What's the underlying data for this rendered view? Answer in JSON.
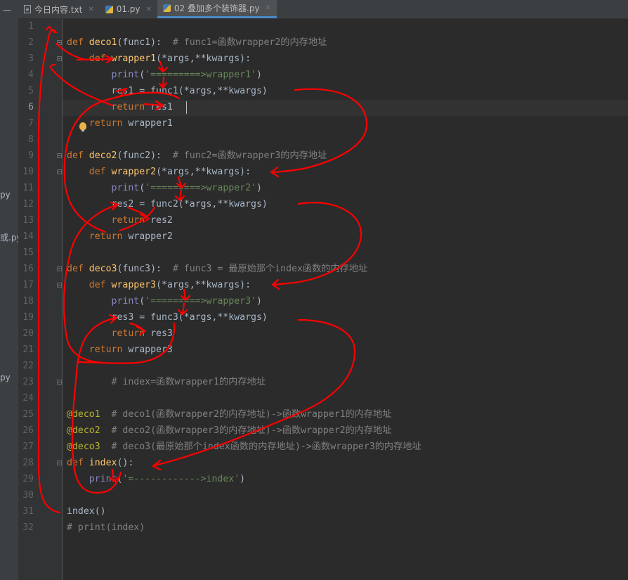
{
  "left_strip": {
    "fragments": [
      "py",
      "或.py",
      "py"
    ]
  },
  "tabs": [
    {
      "label": "今日内容.txt",
      "icon": "text-file-icon",
      "active": false
    },
    {
      "label": "01.py",
      "icon": "python-file-icon",
      "active": false
    },
    {
      "label": "02 叠加多个装饰器.py",
      "icon": "python-file-icon",
      "active": true
    }
  ],
  "editor": {
    "current_line": 6,
    "line_numbers": [
      "1",
      "2",
      "3",
      "4",
      "5",
      "6",
      "7",
      "8",
      "9",
      "10",
      "11",
      "12",
      "13",
      "14",
      "15",
      "16",
      "17",
      "18",
      "19",
      "20",
      "21",
      "22",
      "23",
      "24",
      "25",
      "26",
      "27",
      "28",
      "29",
      "30",
      "31",
      "32"
    ],
    "lines": [
      [],
      [
        [
          "kw",
          "def "
        ],
        [
          "fn",
          "deco1"
        ],
        [
          "p",
          "(func1):  "
        ],
        [
          "com",
          "# func1=函数wrapper2的内存地址"
        ]
      ],
      [
        [
          "p",
          "    "
        ],
        [
          "kw",
          "def "
        ],
        [
          "fn",
          "wrapper1"
        ],
        [
          "p",
          "(*args,**kwargs):"
        ]
      ],
      [
        [
          "p",
          "        "
        ],
        [
          "bi",
          "print"
        ],
        [
          "p",
          "("
        ],
        [
          "str",
          "'=========>wrapper1'"
        ],
        [
          "p",
          ")"
        ]
      ],
      [
        [
          "p",
          "        res1 = func1(*args,**kwargs)"
        ]
      ],
      [
        [
          "p",
          "        "
        ],
        [
          "kw",
          "return "
        ],
        [
          "p",
          "res1"
        ]
      ],
      [
        [
          "p",
          "    "
        ],
        [
          "kw",
          "return "
        ],
        [
          "p",
          "wrapper1"
        ]
      ],
      [],
      [
        [
          "kw",
          "def "
        ],
        [
          "fn",
          "deco2"
        ],
        [
          "p",
          "(func2):  "
        ],
        [
          "com",
          "# func2=函数wrapper3的内存地址"
        ]
      ],
      [
        [
          "p",
          "    "
        ],
        [
          "kw",
          "def "
        ],
        [
          "fn",
          "wrapper2"
        ],
        [
          "p",
          "(*args,**kwargs):"
        ]
      ],
      [
        [
          "p",
          "        "
        ],
        [
          "bi",
          "print"
        ],
        [
          "p",
          "("
        ],
        [
          "str",
          "'=========>wrapper2'"
        ],
        [
          "p",
          ")"
        ]
      ],
      [
        [
          "p",
          "        res2 = func2(*args,**kwargs)"
        ]
      ],
      [
        [
          "p",
          "        "
        ],
        [
          "kw",
          "return "
        ],
        [
          "p",
          "res2"
        ]
      ],
      [
        [
          "p",
          "    "
        ],
        [
          "kw",
          "return "
        ],
        [
          "p",
          "wrapper2"
        ]
      ],
      [],
      [
        [
          "kw",
          "def "
        ],
        [
          "fn",
          "deco3"
        ],
        [
          "p",
          "(func3):  "
        ],
        [
          "com",
          "# func3 = 最原始那个index函数的内存地址"
        ]
      ],
      [
        [
          "p",
          "    "
        ],
        [
          "kw",
          "def "
        ],
        [
          "fn",
          "wrapper3"
        ],
        [
          "p",
          "(*args,**kwargs):"
        ]
      ],
      [
        [
          "p",
          "        "
        ],
        [
          "bi",
          "print"
        ],
        [
          "p",
          "("
        ],
        [
          "str",
          "'=========>wrapper3'"
        ],
        [
          "p",
          ")"
        ]
      ],
      [
        [
          "p",
          "        res3 = func3(*args,**kwargs)"
        ]
      ],
      [
        [
          "p",
          "        "
        ],
        [
          "kw",
          "return "
        ],
        [
          "p",
          "res3"
        ]
      ],
      [
        [
          "p",
          "    "
        ],
        [
          "kw",
          "return "
        ],
        [
          "p",
          "wrapper3"
        ]
      ],
      [],
      [
        [
          "p",
          "        "
        ],
        [
          "com",
          "# index=函数wrapper1的内存地址"
        ]
      ],
      [],
      [
        [
          "dec",
          "@deco1"
        ],
        [
          "p",
          "  "
        ],
        [
          "com",
          "# deco1(函数wrapper2的内存地址)->函数wrapper1的内存地址"
        ]
      ],
      [
        [
          "dec",
          "@deco2"
        ],
        [
          "p",
          "  "
        ],
        [
          "com",
          "# deco2(函数wrapper3的内存地址)->函数wrapper2的内存地址"
        ]
      ],
      [
        [
          "dec",
          "@deco3"
        ],
        [
          "p",
          "  "
        ],
        [
          "com",
          "# deco3(最原始那个index函数的内存地址)->函数wrapper3的内存地址"
        ]
      ],
      [
        [
          "kw",
          "def "
        ],
        [
          "fn",
          "index"
        ],
        [
          "p",
          "():"
        ]
      ],
      [
        [
          "p",
          "    "
        ],
        [
          "bi",
          "print"
        ],
        [
          "p",
          "("
        ],
        [
          "str",
          "'=------------>index'"
        ],
        [
          "p",
          ")"
        ]
      ],
      [],
      [
        [
          "p",
          "index()"
        ]
      ],
      [
        [
          "com",
          "# print(index)"
        ]
      ]
    ]
  }
}
